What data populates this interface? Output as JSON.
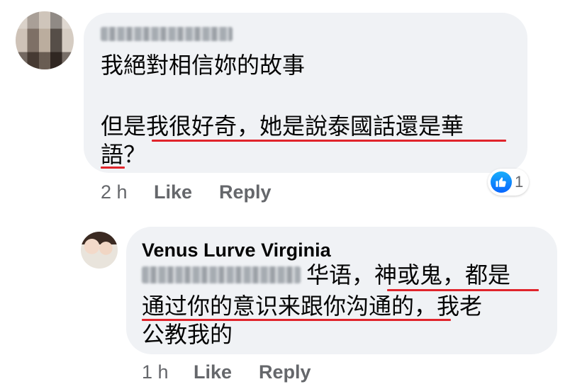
{
  "comment1": {
    "author_name": "",
    "text_line1": "我絕對相信妳的故事",
    "text_line2": "但是我很好奇，她是說泰國話還是華",
    "text_line3": "語？",
    "time": "2 h",
    "like_label": "Like",
    "reply_label": "Reply",
    "reaction": {
      "icon": "thumbs-up-icon",
      "count": "1",
      "color": "#0866ff"
    }
  },
  "comment2": {
    "author_name": "Venus Lurve Virginia",
    "mention": "",
    "text_line1": "华语，神或鬼，都是",
    "text_line2": "通过你的意识来跟你沟通的，我老",
    "text_line3": "公教我的",
    "time": "1 h",
    "like_label": "Like",
    "reply_label": "Reply"
  },
  "colors": {
    "bubble": "#f0f2f5",
    "meta_text": "#65676b",
    "underline_annotation": "#e0242b"
  }
}
